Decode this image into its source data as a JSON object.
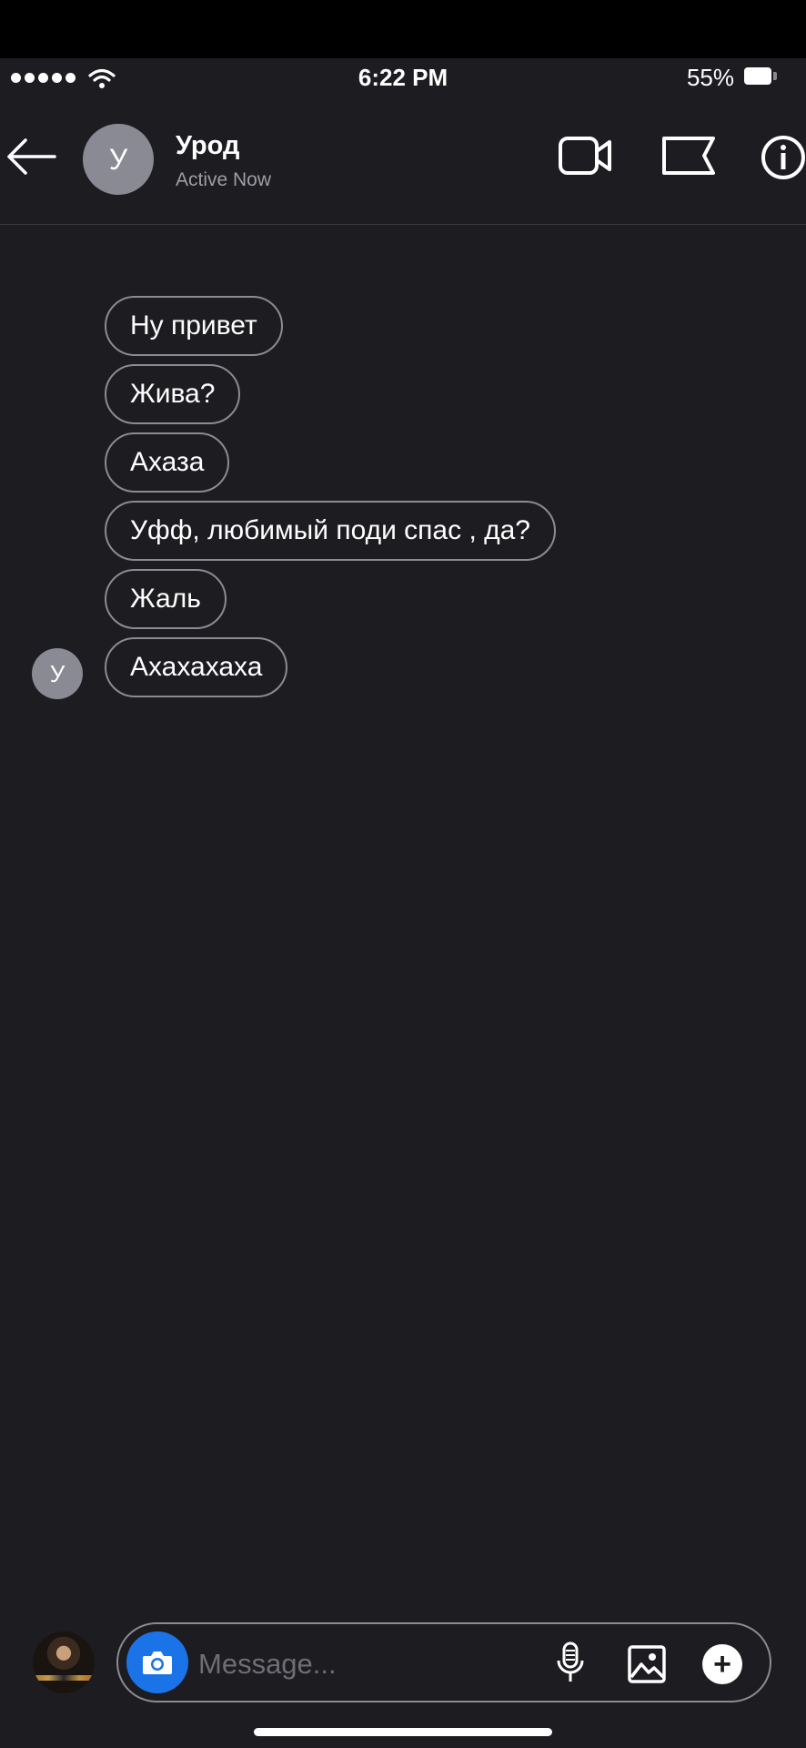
{
  "status_bar": {
    "time": "6:22 PM",
    "battery_percent": "55%",
    "battery_level": 0.55,
    "signal_bars": 5
  },
  "header": {
    "back_icon": "arrow-left-icon",
    "avatar_letter": "У",
    "contact_name": "Урод",
    "contact_status": "Active Now",
    "actions": [
      "video-call-icon",
      "flag-icon",
      "info-icon"
    ]
  },
  "messages": [
    {
      "text": "Ну привет"
    },
    {
      "text": "Жива?"
    },
    {
      "text": "Ахаза"
    },
    {
      "text": "Уфф, любимый поди спас , да?"
    },
    {
      "text": "Жаль"
    },
    {
      "text": "Ахахахаха"
    }
  ],
  "sender_avatar_letter": "У",
  "composer": {
    "placeholder": "Message...",
    "icons": [
      "camera-icon",
      "microphone-icon",
      "gallery-icon",
      "plus-icon"
    ]
  },
  "colors": {
    "background": "#1d1c20",
    "accent_blue": "#1a74e8",
    "avatar_gray": "#8a8a94",
    "bubble_border": "#8c8b91"
  }
}
